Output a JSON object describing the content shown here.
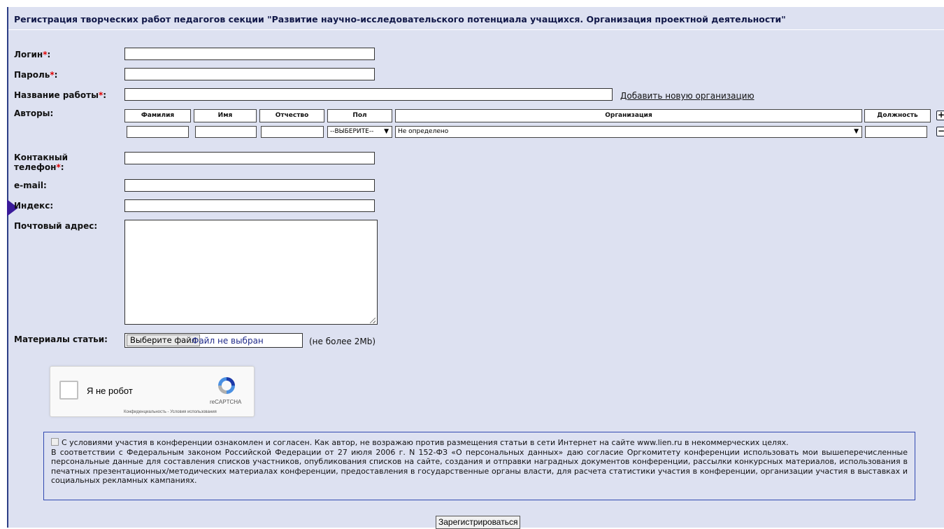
{
  "page": {
    "title": "Регистрация творческих работ педагогов секции \"Развитие научно-исследовательского потенциала учащихся. Организация проектной деятельности\""
  },
  "form": {
    "login": {
      "label": "Логин",
      "required": "*",
      "colon": ":",
      "value": ""
    },
    "password": {
      "label": "Пароль",
      "required": "*",
      "colon": ":",
      "value": ""
    },
    "work_title": {
      "label": "Название работы",
      "required": "*",
      "colon": ":",
      "value": ""
    },
    "add_org_link": "Добавить новую организацию",
    "authors": {
      "label": "Авторы:",
      "columns": [
        "Фамилия",
        "Имя",
        "Отчество",
        "Пол",
        "Организация",
        "Должность"
      ],
      "row": {
        "surname": "",
        "name": "",
        "patronymic": "",
        "gender": "--ВЫБЕРИТЕ--",
        "organization": "Не определено",
        "position": ""
      },
      "add_icon": "+",
      "remove_icon": "−"
    },
    "phone": {
      "label_line1": "Контакный",
      "label_line2": "телефон",
      "required": "*",
      "colon": ":",
      "value": ""
    },
    "email": {
      "label": "e-mail:",
      "value": ""
    },
    "index": {
      "label": "Индекс:",
      "value": ""
    },
    "address": {
      "label": "Почтовый адрес:",
      "value": ""
    },
    "materials": {
      "label": "Материалы статьи:",
      "button": "Выберите файл",
      "status": "Файл не выбран",
      "note": "(не более 2Mb)"
    }
  },
  "captcha": {
    "label": "Я не робот",
    "brand": "reCAPTCHA",
    "links": "Конфиденциальность - Условия использования"
  },
  "consent": {
    "line1": "С условиями участия в конференции ознакомлен и согласен. Как автор, не возражаю против размещения статьи в сети Интернет на сайте www.lien.ru в некоммерческих целях.",
    "line2": "В соответствии с Федеральным законом Российской Федерации от 27 июля 2006 г. N 152-ФЗ «О персональных данных» даю согласие Оргкомитету конференции использовать мои вышеперечисленные персональные данные для составления списков участников, опубликования списков на сайте, создания и отправки наградных документов конференции, рассылки конкурсных материалов, использования в печатных презентационных/методических материалах конференции, предоставления в государственные органы власти, для расчета статистики участия в конференции, организации участия в выставках и социальных рекламных кампаниях."
  },
  "submit": "Зарегистрироваться",
  "colors": {
    "background": "#dde1f1",
    "border": "#2c3e86",
    "required": "#e00000"
  }
}
